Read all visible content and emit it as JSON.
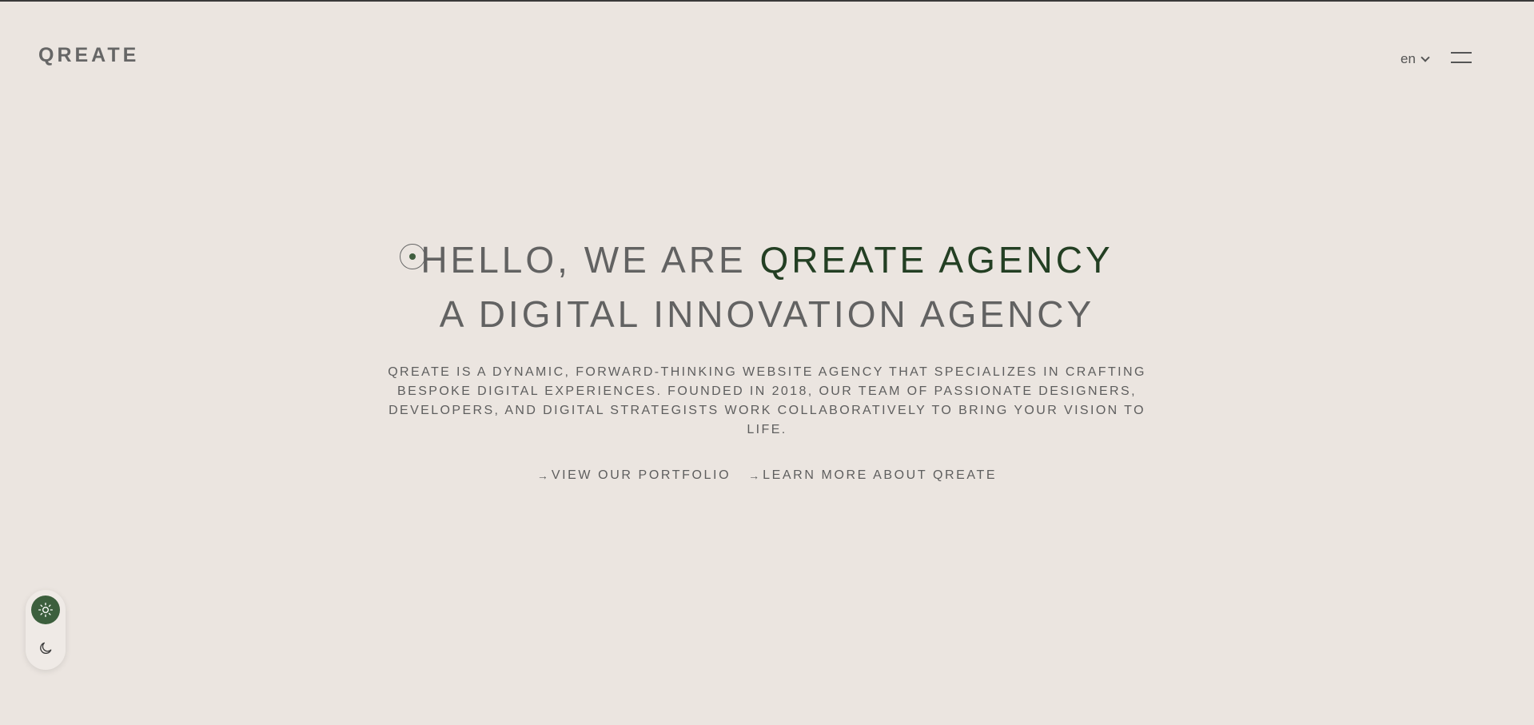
{
  "header": {
    "logo": "QREATE",
    "language": "en"
  },
  "hero": {
    "headline_prefix": "HELLO, WE ARE ",
    "headline_accent": "QREATE AGENCY",
    "subheadline": "A DIGITAL INNOVATION AGENCY",
    "description": "QREATE IS A DYNAMIC, FORWARD-THINKING WEBSITE AGENCY THAT SPECIALIZES IN CRAFTING BESPOKE DIGITAL EXPERIENCES. FOUNDED IN 2018, OUR TEAM OF PASSIONATE DESIGNERS, DEVELOPERS, AND DIGITAL STRATEGISTS WORK COLLABORATIVELY TO BRING YOUR VISION TO LIFE.",
    "links": {
      "portfolio": "VIEW OUR PORTFOLIO",
      "about": "LEARN MORE ABOUT QREATE"
    }
  },
  "theme": {
    "active": "light"
  },
  "colors": {
    "background": "#ebe5e0",
    "accent_green": "#233f23",
    "toggle_green": "#3c5f3d",
    "text_gray": "#626262"
  },
  "icons": {
    "target": "target-icon",
    "menu": "hamburger-menu-icon",
    "chevron": "chevron-down-icon",
    "arrow": "arrow-right-icon",
    "sun": "sun-icon",
    "moon": "moon-icon"
  }
}
